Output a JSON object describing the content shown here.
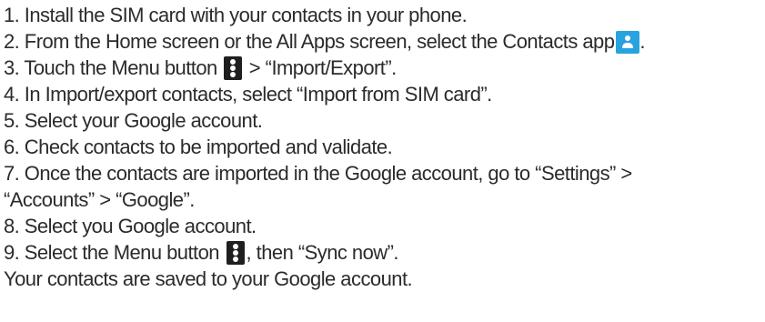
{
  "steps": [
    {
      "text": "1. Install the SIM card with your contacts in your phone."
    },
    {
      "before": "2. From the Home screen or the All Apps screen, select the Contacts app",
      "icon": "contacts-app-icon",
      "after": "."
    },
    {
      "before": "3. Touch the Menu button",
      "icon": "menu-kebab-icon",
      "after": " > “Import/Export”."
    },
    {
      "text": "4. In Import/export contacts, select “Import from SIM card”."
    },
    {
      "text": "5. Select your Google account."
    },
    {
      "text": "6. Check contacts to be imported and validate."
    },
    {
      "text": "7. Once the contacts are imported in the Google account, go to “Settings” >"
    },
    {
      "text": "“Accounts” > “Google”."
    },
    {
      "text": "8. Select you Google account."
    },
    {
      "before": "9. Select the Menu button",
      "icon": "menu-kebab-icon",
      "after": ", then “Sync now”."
    },
    {
      "text": "Your contacts are saved to your Google account."
    }
  ],
  "colors": {
    "text": "#2b2b2b",
    "contacts_icon": "#29a3e0",
    "menu_icon": "#1f1f1f"
  }
}
